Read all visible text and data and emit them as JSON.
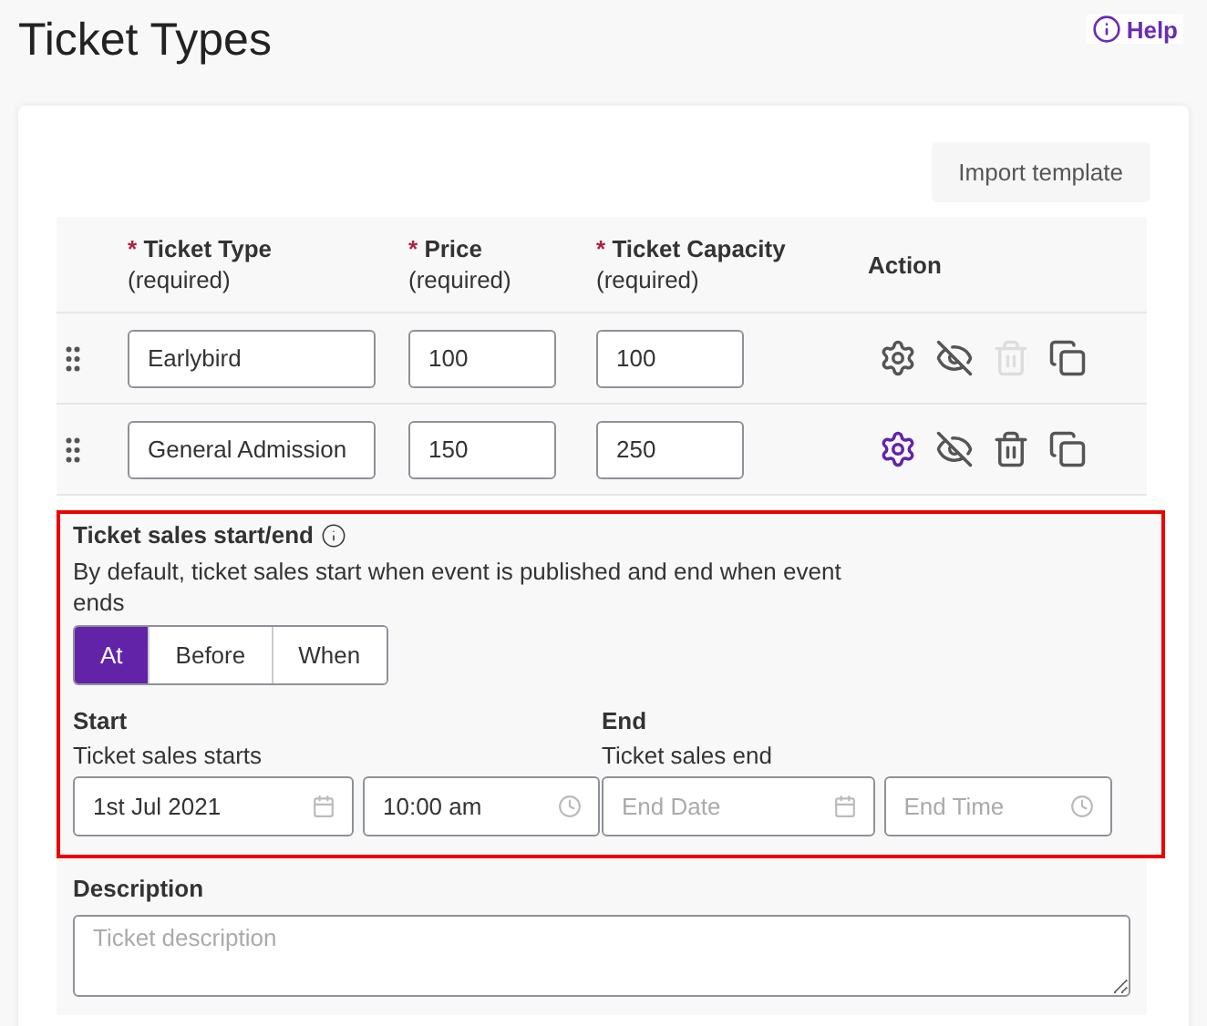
{
  "page": {
    "title": "Ticket Types",
    "help": "Help"
  },
  "import_button": "Import template",
  "columns": [
    {
      "marker": "*",
      "label": "Ticket Type",
      "note": "(required)"
    },
    {
      "marker": "*",
      "label": "Price",
      "note": "(required)"
    },
    {
      "marker": "*",
      "label": "Ticket Capacity",
      "note": "(required)"
    },
    {
      "label": "Action"
    }
  ],
  "rows": [
    {
      "name": "Earlybird",
      "price": "100",
      "capacity": "100",
      "selected": false,
      "delete_disabled": true
    },
    {
      "name": "General Admission",
      "price": "150",
      "capacity": "250",
      "selected": true,
      "delete_disabled": false
    }
  ],
  "sales": {
    "title": "Ticket sales start/end",
    "description": "By default, ticket sales start when event is published and end when event ends",
    "modes": [
      {
        "label": "At",
        "selected": true
      },
      {
        "label": "Before",
        "selected": false
      },
      {
        "label": "When",
        "selected": false
      }
    ],
    "start": {
      "heading": "Start",
      "label": "Ticket sales starts",
      "date": {
        "value": "1st Jul 2021"
      },
      "time": {
        "value": "10:00 am"
      }
    },
    "end": {
      "heading": "End",
      "label": "Ticket sales end",
      "date": {
        "placeholder": "End Date"
      },
      "time": {
        "placeholder": "End Time"
      }
    }
  },
  "description": {
    "label": "Description",
    "placeholder": "Ticket description"
  }
}
